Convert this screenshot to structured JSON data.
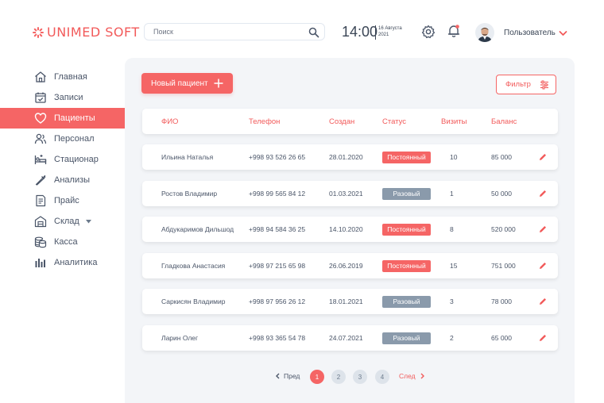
{
  "brand": {
    "name": "UNIMED SOFT",
    "accent": "#f56565"
  },
  "header": {
    "search_placeholder": "Поиск",
    "time": "14:00",
    "date_line1": "16 Августа",
    "date_line2": "2021",
    "user_label": "Пользователь",
    "icons": [
      "settings-icon",
      "bell-icon",
      "chevron-down-icon"
    ]
  },
  "sidebar": {
    "items": [
      {
        "label": "Главная",
        "icon": "home-icon"
      },
      {
        "label": "Записи",
        "icon": "calendar-check-icon"
      },
      {
        "label": "Пациенты",
        "icon": "heart-icon",
        "active": true
      },
      {
        "label": "Персонал",
        "icon": "staff-icon"
      },
      {
        "label": "Стационар",
        "icon": "bed-icon"
      },
      {
        "label": "Анализы",
        "icon": "pipette-icon"
      },
      {
        "label": "Прайс",
        "icon": "price-list-icon"
      },
      {
        "label": "Склад",
        "icon": "warehouse-icon",
        "has_caret": true
      },
      {
        "label": "Касса",
        "icon": "coins-icon"
      },
      {
        "label": "Аналитика",
        "icon": "bar-chart-icon"
      }
    ]
  },
  "toolbar": {
    "new_patient_label": "Новый пациент",
    "filter_label": "Фильтр"
  },
  "table": {
    "columns": [
      "ФИО",
      "Телефон",
      "Создан",
      "Статус",
      "Визиты",
      "Баланс"
    ],
    "rows": [
      {
        "name": "Ильина Наталья",
        "phone": "+998 93 526 26 65",
        "created": "28.01.2020",
        "status": "Постоянный",
        "visits": "10",
        "balance": "85 000"
      },
      {
        "name": "Ростов Владимир",
        "phone": "+998 99 565 84 12",
        "created": "01.03.2021",
        "status": "Разовый",
        "visits": "1",
        "balance": "50 000"
      },
      {
        "name": "Абдукаримов Дильшод",
        "phone": "+998 94 584 36 25",
        "created": "14.10.2020",
        "status": "Постоянный",
        "visits": "8",
        "balance": "520 000"
      },
      {
        "name": "Гладкова Анастасия",
        "phone": "+998 97 215 65 98",
        "created": "26.06.2019",
        "status": "Постоянный",
        "visits": "15",
        "balance": "751 000"
      },
      {
        "name": "Саркисян Владимир",
        "phone": "+998 97 956 26 12",
        "created": "18.01.2021",
        "status": "Разовый",
        "visits": "3",
        "balance": "78 000"
      },
      {
        "name": "Ларин Олег",
        "phone": "+998 93 365 54 78",
        "created": "24.07.2021",
        "status": "Разовый",
        "visits": "2",
        "balance": "65 000"
      }
    ]
  },
  "pagination": {
    "prev_label": "Пред",
    "next_label": "След",
    "pages": [
      "1",
      "2",
      "3",
      "4"
    ],
    "current": "1"
  }
}
